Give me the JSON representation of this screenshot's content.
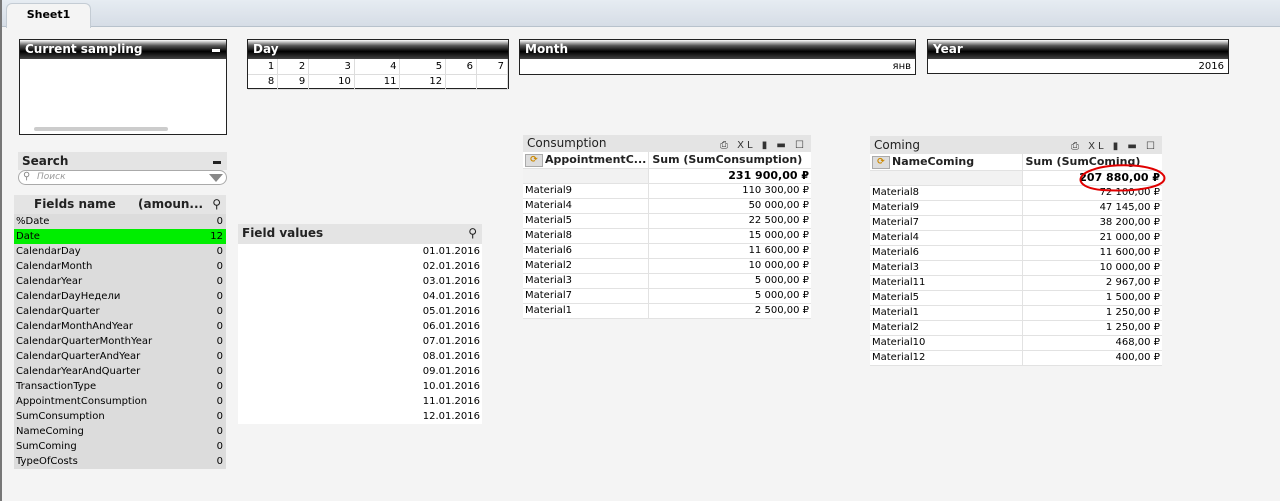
{
  "sheet_tab": "Sheet1",
  "current_sampling": {
    "title": "Current sampling"
  },
  "day": {
    "title": "Day",
    "values": [
      "1",
      "2",
      "3",
      "4",
      "5",
      "6",
      "7",
      "8",
      "9",
      "10",
      "11",
      "12",
      "",
      ""
    ]
  },
  "month": {
    "title": "Month",
    "value": "янв"
  },
  "year": {
    "title": "Year",
    "value": "2016"
  },
  "search": {
    "title": "Search",
    "placeholder": "Поиск"
  },
  "fields": {
    "col1": "Fields name",
    "col2": "(amoun...",
    "selected_color": "#00ee00",
    "rows": [
      {
        "name": "%Date",
        "count": "0"
      },
      {
        "name": "Date",
        "count": "12",
        "selected": true
      },
      {
        "name": "CalendarDay",
        "count": "0"
      },
      {
        "name": "CalendarMonth",
        "count": "0"
      },
      {
        "name": "CalendarYear",
        "count": "0"
      },
      {
        "name": "CalendarDayНедели",
        "count": "0"
      },
      {
        "name": "CalendarQuarter",
        "count": "0"
      },
      {
        "name": "CalendarMonthAndYear",
        "count": "0"
      },
      {
        "name": "CalendarQuarterMonthYear",
        "count": "0"
      },
      {
        "name": "CalendarQuarterAndYear",
        "count": "0"
      },
      {
        "name": "CalendarYearAndQuarter",
        "count": "0"
      },
      {
        "name": "TransactionType",
        "count": "0"
      },
      {
        "name": "AppointmentConsumption",
        "count": "0"
      },
      {
        "name": "SumConsumption",
        "count": "0"
      },
      {
        "name": "NameComing",
        "count": "0"
      },
      {
        "name": "SumComing",
        "count": "0"
      },
      {
        "name": "TypeOfCosts",
        "count": "0"
      }
    ]
  },
  "field_values": {
    "title": "Field values",
    "values": [
      "01.01.2016",
      "02.01.2016",
      "03.01.2016",
      "04.01.2016",
      "05.01.2016",
      "06.01.2016",
      "07.01.2016",
      "08.01.2016",
      "09.01.2016",
      "10.01.2016",
      "11.01.2016",
      "12.01.2016"
    ]
  },
  "consumption": {
    "title": "Consumption",
    "icons": "XL",
    "col1": "AppointmentC...",
    "col2": "Sum (SumConsumption)",
    "total": "231 900,00 ₽",
    "rows": [
      {
        "name": "Material9",
        "value": "110 300,00 ₽"
      },
      {
        "name": "Material4",
        "value": "50 000,00 ₽"
      },
      {
        "name": "Material5",
        "value": "22 500,00 ₽"
      },
      {
        "name": "Material8",
        "value": "15 000,00 ₽"
      },
      {
        "name": "Material6",
        "value": "11 600,00 ₽"
      },
      {
        "name": "Material2",
        "value": "10 000,00 ₽"
      },
      {
        "name": "Material3",
        "value": "5 000,00 ₽"
      },
      {
        "name": "Material7",
        "value": "5 000,00 ₽"
      },
      {
        "name": "Material1",
        "value": "2 500,00 ₽"
      }
    ]
  },
  "coming": {
    "title": "Coming",
    "icons": "XL",
    "col1": "NameComing",
    "col2": "Sum (SumComing)",
    "total": "207 880,00 ₽",
    "annotation_color": "#e00000",
    "rows": [
      {
        "name": "Material8",
        "value": "72 100,00 ₽"
      },
      {
        "name": "Material9",
        "value": "47 145,00 ₽"
      },
      {
        "name": "Material7",
        "value": "38 200,00 ₽"
      },
      {
        "name": "Material4",
        "value": "21 000,00 ₽"
      },
      {
        "name": "Material6",
        "value": "11 600,00 ₽"
      },
      {
        "name": "Material3",
        "value": "10 000,00 ₽"
      },
      {
        "name": "Material11",
        "value": "2 967,00 ₽"
      },
      {
        "name": "Material5",
        "value": "1 500,00 ₽"
      },
      {
        "name": "Material1",
        "value": "1 250,00 ₽"
      },
      {
        "name": "Material2",
        "value": "1 250,00 ₽"
      },
      {
        "name": "Material10",
        "value": "468,00 ₽"
      },
      {
        "name": "Material12",
        "value": "400,00 ₽"
      }
    ]
  }
}
